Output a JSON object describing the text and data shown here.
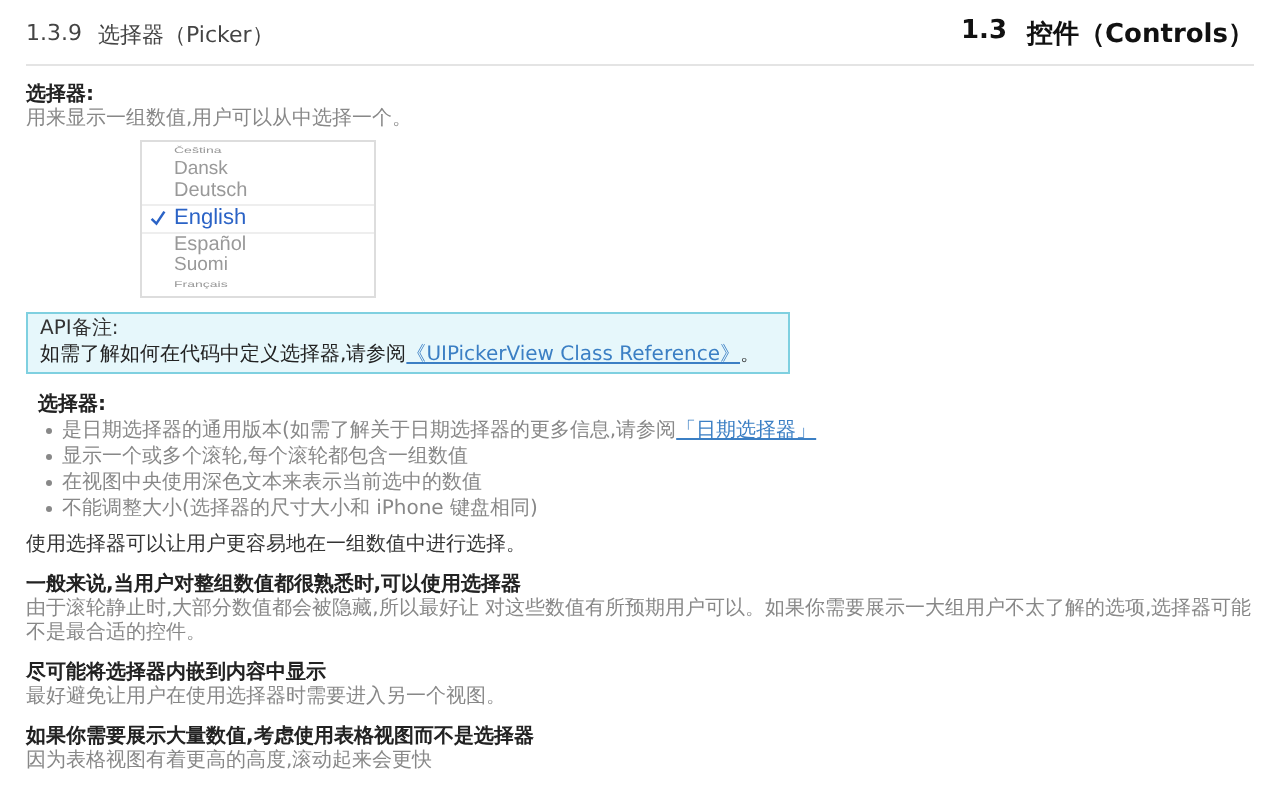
{
  "header": {
    "section": "1.3.9",
    "title": "选择器（Picker）",
    "chapter_number": "1.3",
    "chapter_title": "控件（Controls）"
  },
  "intro": {
    "title": "选择器:",
    "description": "用来显示一组数值,用户可以从中选择一个。"
  },
  "picker": {
    "items": [
      {
        "label": "Čeština",
        "selected": false
      },
      {
        "label": "Dansk",
        "selected": false
      },
      {
        "label": "Deutsch",
        "selected": false
      },
      {
        "label": "English",
        "selected": true
      },
      {
        "label": "Español",
        "selected": false
      },
      {
        "label": "Suomi",
        "selected": false
      },
      {
        "label": "Français",
        "selected": false
      }
    ]
  },
  "api_note": {
    "title": "API备注:",
    "text": "如需了解如何在代码中定义选择器,请参阅",
    "link": "《UIPickerView Class Reference》",
    "after": "。"
  },
  "features": {
    "title": "选择器:",
    "bullets": [
      {
        "text": "是日期选择器的通用版本(如需了解关于日期选择器的更多信息,请参阅",
        "link": "「日期选择器」"
      },
      {
        "text": "显示一个或多个滚轮,每个滚轮都包含一组数值"
      },
      {
        "text": "在视图中央使用深色文本来表示当前选中的数值"
      },
      {
        "text": "不能调整大小(选择器的尺寸大小和 iPhone 键盘相同)"
      }
    ],
    "summary": "使用选择器可以让用户更容易地在一组数值中进行选择。"
  },
  "guidelines": [
    {
      "title": "一般来说,当用户对整组数值都很熟悉时,可以使用选择器",
      "text": "由于滚轮静止时,大部分数值都会被隐藏,所以最好让 对这些数值有所预期用户可以。如果你需要展示一大组用户不太了解的选项,选择器可能不是最合适的控件。"
    },
    {
      "title": "尽可能将选择器内嵌到内容中显示",
      "text": "最好避免让用户在使用选择器时需要进入另一个视图。"
    },
    {
      "title": "如果你需要展示大量数值,考虑使用表格视图而不是选择器",
      "text": "因为表格视图有着更高的高度,滚动起来会更快"
    }
  ]
}
